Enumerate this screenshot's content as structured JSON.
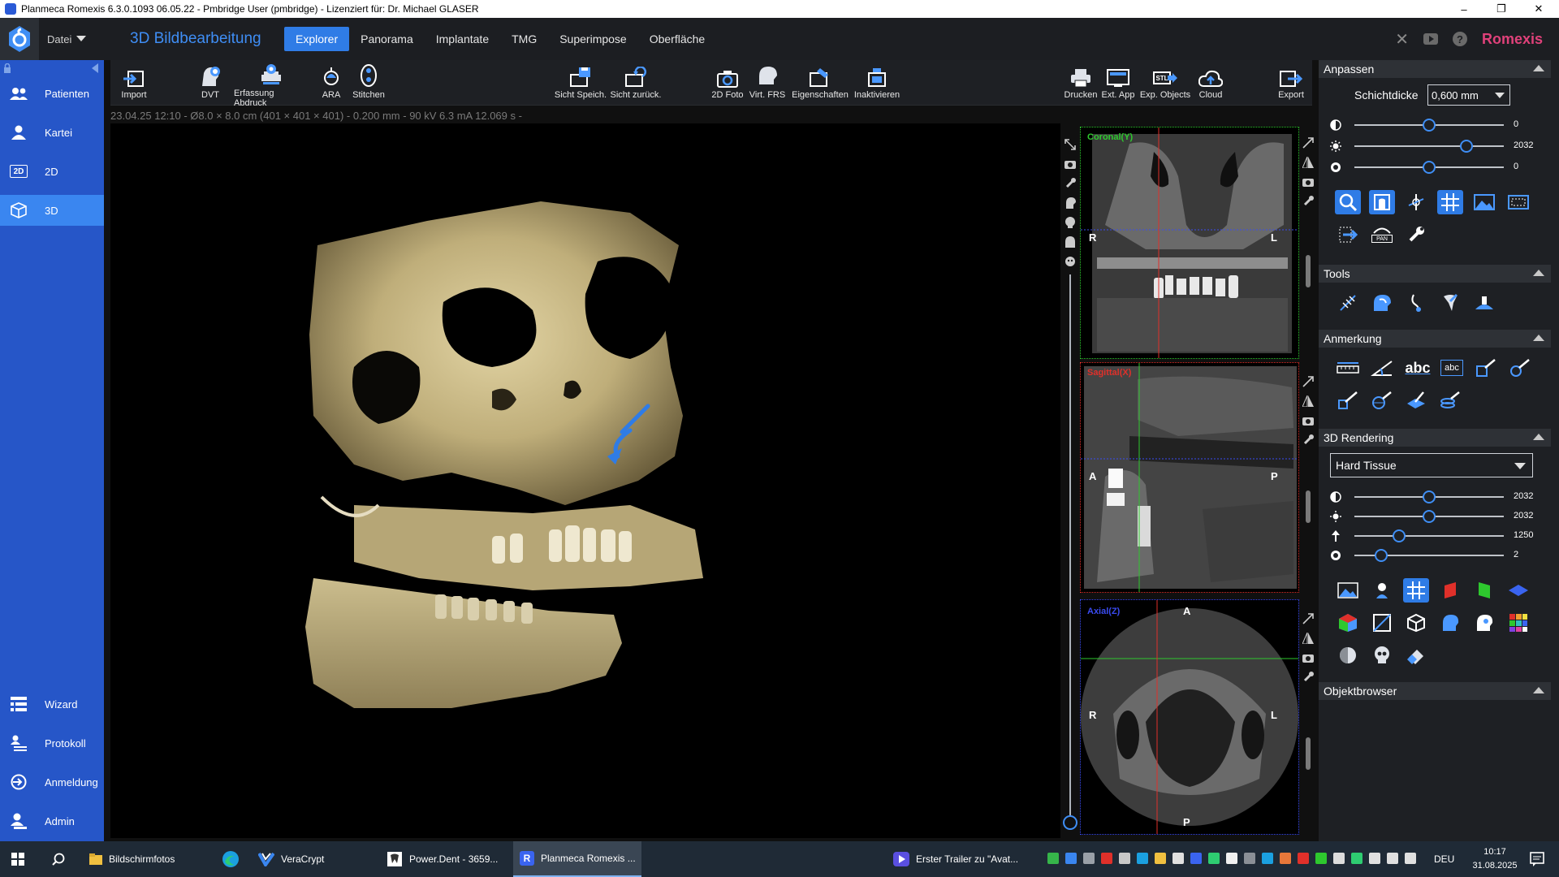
{
  "titlebar": {
    "title": "Planmeca Romexis 6.3.0.1093 06.05.22 - Pmbridge User (pmbridge) - Lizenziert für: Dr. Michael GLASER",
    "minimize": "–",
    "maximize": "❐",
    "close": "✕"
  },
  "header": {
    "datei_label": "Datei",
    "module_title": "3D Bildbearbeitung",
    "tabs": [
      {
        "label": "Explorer",
        "active": true
      },
      {
        "label": "Panorama"
      },
      {
        "label": "Implantate"
      },
      {
        "label": "TMG"
      },
      {
        "label": "Superimpose"
      },
      {
        "label": "Oberfläche"
      }
    ],
    "close_glyph": "✕",
    "help_glyph": "?",
    "brand": "Romexis"
  },
  "sidebar": {
    "top_items": [
      {
        "label": "Patienten",
        "icon": "patients-icon"
      },
      {
        "label": "Kartei",
        "icon": "person-icon"
      },
      {
        "label": "2D",
        "icon": "2d-icon",
        "badge": "2D"
      },
      {
        "label": "3D",
        "icon": "cube-icon",
        "active": true
      }
    ],
    "bottom_items": [
      {
        "label": "Wizard",
        "icon": "wizard-icon"
      },
      {
        "label": "Protokoll",
        "icon": "protocol-icon"
      },
      {
        "label": "Anmeldung",
        "icon": "login-icon"
      },
      {
        "label": "Admin",
        "icon": "admin-icon"
      }
    ]
  },
  "toolbar": {
    "items": [
      {
        "label": "Import",
        "icon": "import-icon"
      },
      {
        "label": "DVT",
        "icon": "dvt-icon"
      },
      {
        "label": "Erfassung Abdruck",
        "icon": "impression-icon"
      },
      {
        "label": "ARA",
        "icon": "ara-icon"
      },
      {
        "label": "Stitchen",
        "icon": "stitch-icon"
      },
      {
        "label": "Sicht Speich.",
        "icon": "save-view-icon"
      },
      {
        "label": "Sicht zurück.",
        "icon": "restore-view-icon"
      },
      {
        "label": "2D Foto",
        "icon": "camera-icon"
      },
      {
        "label": "Virt. FRS",
        "icon": "head-icon"
      },
      {
        "label": "Eigenschaften",
        "icon": "properties-icon"
      },
      {
        "label": "Inaktivieren",
        "icon": "deactivate-icon"
      },
      {
        "label": "Drucken",
        "icon": "print-icon"
      },
      {
        "label": "Ext. App",
        "icon": "ext-app-icon"
      },
      {
        "label": "Exp. Objects",
        "icon": "export-objects-icon",
        "badge": "STL"
      },
      {
        "label": "Cloud",
        "icon": "cloud-icon"
      },
      {
        "label": "Export",
        "icon": "export-icon"
      }
    ]
  },
  "info": "23.04.25 12:10 - Ø8.0 × 8.0 cm (401 × 401 × 401) - 0.200 mm - 90 kV 6.3 mA 12.069 s -",
  "views": {
    "coronal": {
      "label": "Coronal(Y)",
      "left": "R",
      "right": "L",
      "color": "#2ec82e"
    },
    "sagittal": {
      "label": "Sagittal(X)",
      "left": "A",
      "right": "P",
      "color": "#e0302a"
    },
    "axial": {
      "label": "Axial(Z)",
      "top": "A",
      "left": "R",
      "right": "L",
      "bottom": "P",
      "color": "#3a4bf0"
    }
  },
  "right_panel": {
    "anpassen": {
      "title": "Anpassen",
      "schichtdicke_label": "Schichtdicke",
      "schichtdicke_value": "0,600 mm",
      "sliders": [
        {
          "icon": "contrast-icon",
          "value": "0",
          "level": 0.5
        },
        {
          "icon": "brightness-icon",
          "value": "2032",
          "level": 0.75
        },
        {
          "icon": "sharpness-icon",
          "value": "0",
          "level": 0.5
        }
      ]
    },
    "tools": {
      "title": "Tools"
    },
    "anmerkung": {
      "title": "Anmerkung",
      "abc_label": "abc",
      "abc_box_label": "abc"
    },
    "rendering": {
      "title": "3D Rendering",
      "preset": "Hard Tissue",
      "sliders": [
        {
          "icon": "contrast-icon",
          "value": "2032",
          "level": 0.5
        },
        {
          "icon": "brightness-icon",
          "value": "2032",
          "level": 0.5
        },
        {
          "icon": "threshold-icon",
          "value": "1250",
          "level": 0.3
        },
        {
          "icon": "sharpness-icon",
          "value": "2",
          "level": 0.18
        }
      ]
    },
    "objektbrowser": {
      "title": "Objektbrowser"
    },
    "pan_badge": "PAN"
  },
  "taskbar": {
    "tasks": [
      {
        "label": "Bildschirmfotos",
        "icon": "folder-icon"
      },
      {
        "label": "",
        "icon": "edge-icon"
      },
      {
        "label": "VeraCrypt",
        "icon": "veracrypt-icon"
      },
      {
        "label": "Power.Dent  -  3659...",
        "icon": "powerdent-icon"
      },
      {
        "label": "Planmeca Romexis ...",
        "icon": "romexis-icon",
        "active": true
      }
    ],
    "media": "Erster Trailer zu \"Avat...",
    "language": "DEU",
    "time": "10:17",
    "date": "31.08.2025"
  },
  "colors": {
    "accent": "#2f7ce6",
    "sidebar": "#2656c8",
    "brand": "#e0417a",
    "bone": "#c9b98c"
  }
}
